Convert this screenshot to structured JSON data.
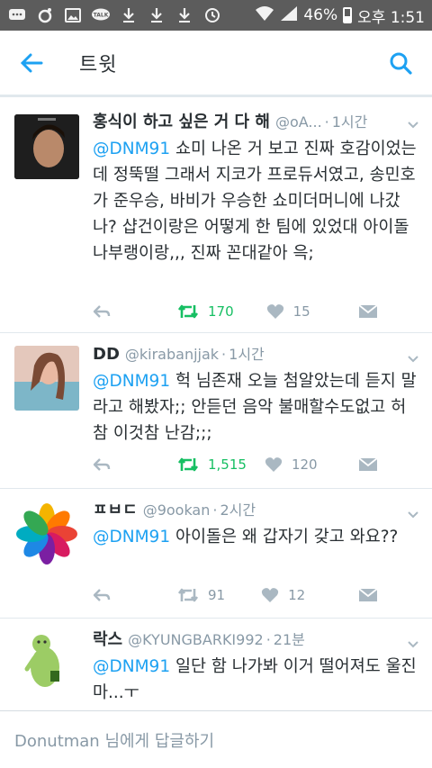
{
  "statusbar": {
    "battery": "46%",
    "time": "오후 1:51"
  },
  "header": {
    "title": "트윗"
  },
  "tweets": [
    {
      "name": "홍식이 하고 싶은 거 다 해",
      "handle": "@oA...",
      "time": "1시간",
      "mention": "@DNM91",
      "text": " 쇼미 나온 거 보고 진짜 호감이었는데 정뚝떨 그래서 지코가 프로듀서였고, 송민호가 준우승, 바비가 우승한 쇼미더머니에 나갔나? 샵건이랑은 어떻게 한 팀에 있었대 아이돌 나부랭이랑,,, 진짜 꼰대같아 윽;",
      "retweets": "170",
      "likes": "15"
    },
    {
      "name": "DD",
      "handle": "@kirabanjjak",
      "time": "1시간",
      "mention": "@DNM91",
      "text": " 헉 님존재 오늘 첨알았는데 듣지 말라고 해봤자;; 안듣던 음악 불매할수도없고 허 참 이것참 난감;;;",
      "retweets": "1,515",
      "likes": "120"
    },
    {
      "name": "ㅍㅂㄷ",
      "handle": "@9ookan",
      "time": "2시간",
      "mention": "@DNM91",
      "text": " 아이돌은 왜 갑자기 갖고 와요??",
      "retweets": "91",
      "likes": "12"
    },
    {
      "name": "락스",
      "handle": "@KYUNGBARKI992",
      "time": "21분",
      "mention": "@DNM91",
      "text": " 일단 함 나가봐 이거 떨어져도 울진 마...ㅜ"
    }
  ],
  "reply": {
    "placeholder": "Donutman 님에게 답글하기"
  },
  "colors": {
    "accent": "#1da1f2",
    "retweet_active": "#17bf63",
    "meta_gray": "#8899a6"
  }
}
